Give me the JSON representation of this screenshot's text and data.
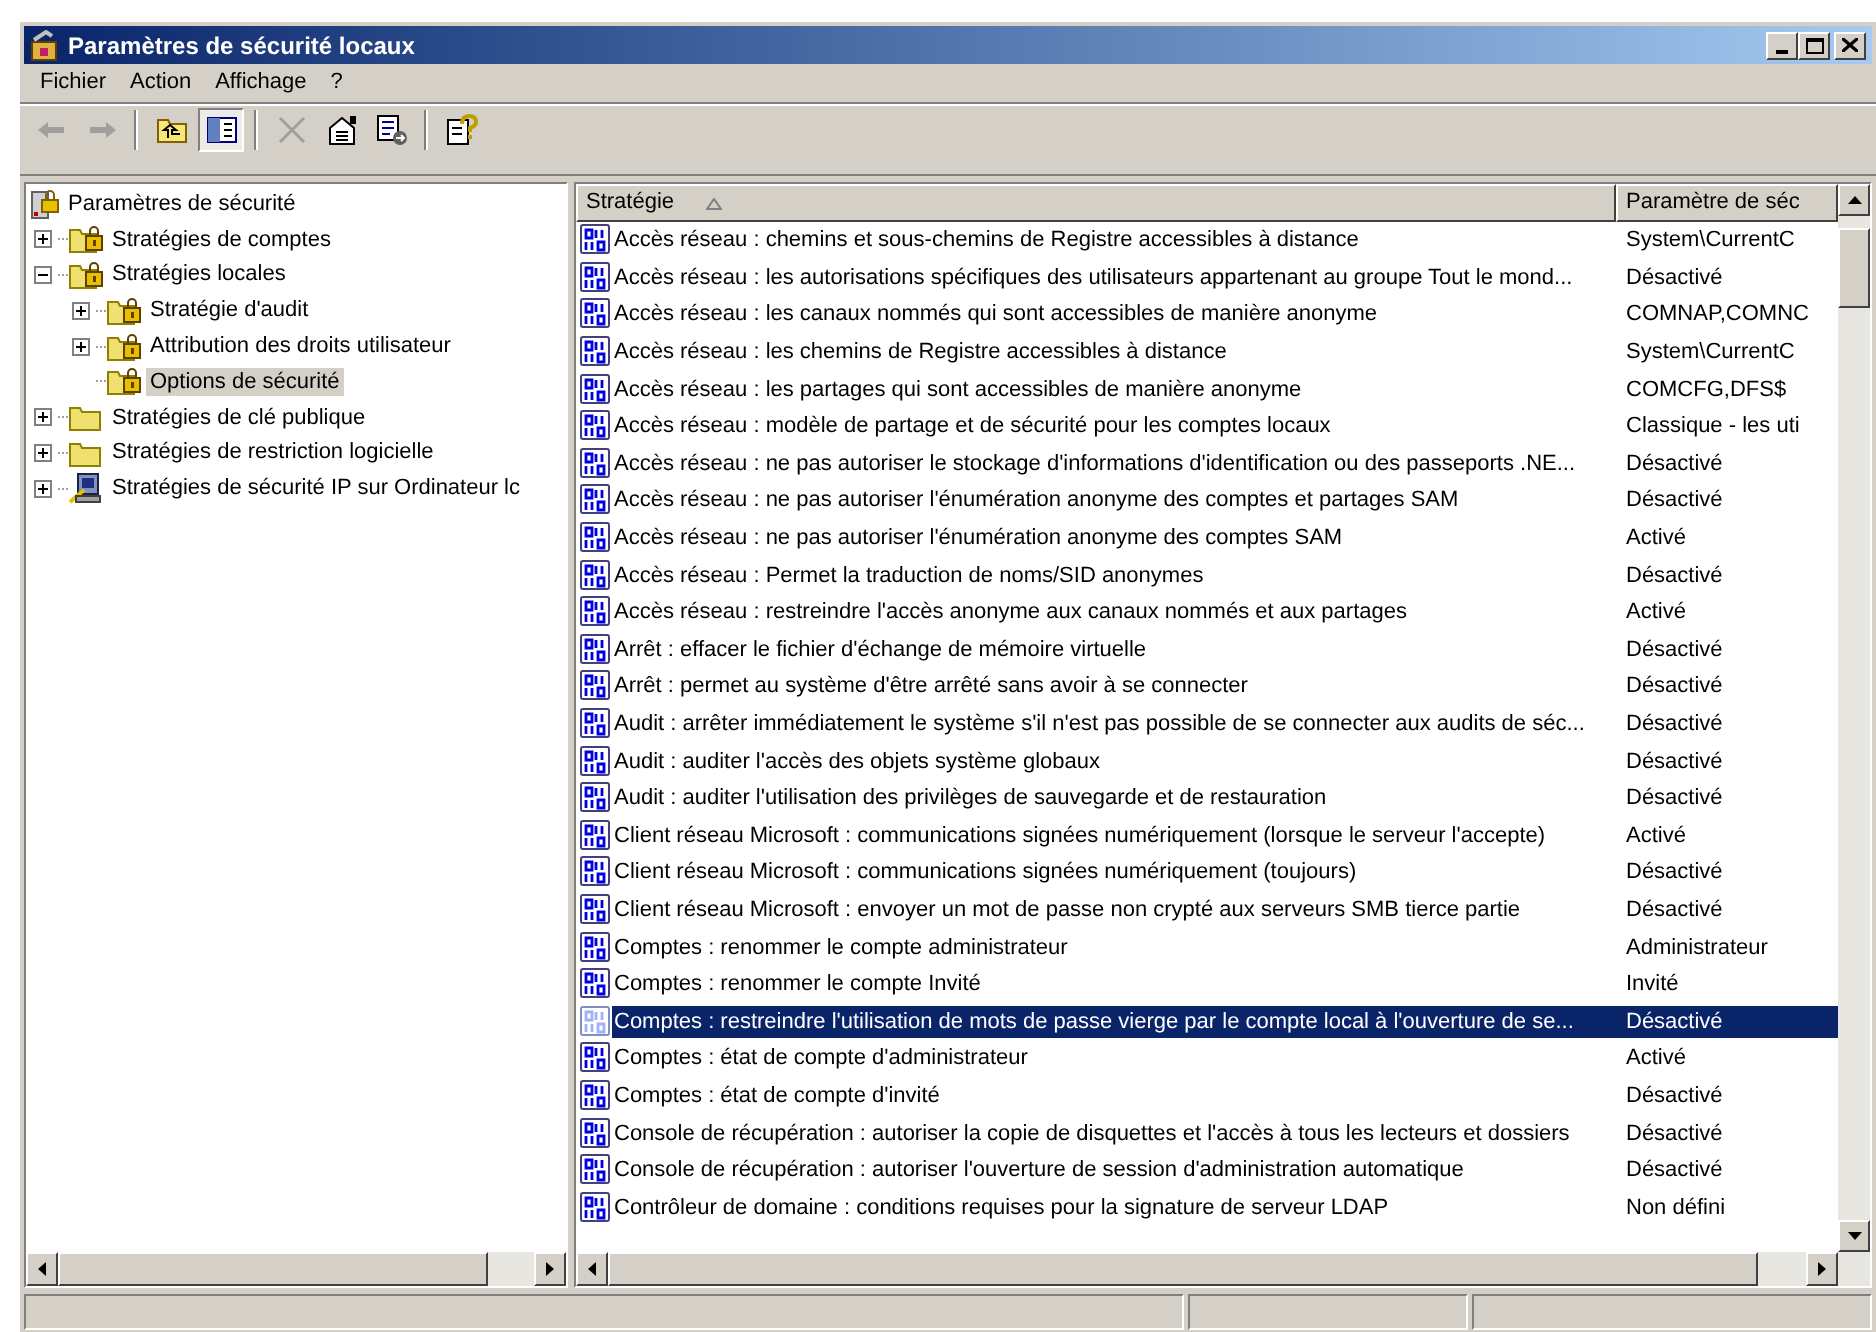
{
  "window": {
    "title": "Paramètres de sécurité locaux"
  },
  "menu": [
    {
      "label": "Fichier"
    },
    {
      "label": "Action"
    },
    {
      "label": "Affichage"
    },
    {
      "label": "?"
    }
  ],
  "toolbar": [
    {
      "kind": "back",
      "disabled": true
    },
    {
      "kind": "forward",
      "disabled": true
    },
    {
      "kind": "separator"
    },
    {
      "kind": "up",
      "disabled": false
    },
    {
      "kind": "tree",
      "disabled": false,
      "pressed": true
    },
    {
      "kind": "separator"
    },
    {
      "kind": "delete",
      "disabled": true
    },
    {
      "kind": "properties",
      "disabled": false
    },
    {
      "kind": "export",
      "disabled": false
    },
    {
      "kind": "separator"
    },
    {
      "kind": "help",
      "disabled": false
    }
  ],
  "tree": [
    {
      "label": "Paramètres de sécurité",
      "kind": "root",
      "selected": false,
      "children": [
        {
          "label": "Stratégies de comptes",
          "kind": "lockfolder",
          "selected": false,
          "expanded": false
        },
        {
          "label": "Stratégies locales",
          "kind": "lockfolder",
          "selected": false,
          "expanded": true,
          "children": [
            {
              "label": "Stratégie d'audit",
              "kind": "lockfolder",
              "selected": false,
              "expanded": false
            },
            {
              "label": "Attribution des droits utilisateur",
              "kind": "lockfolder",
              "selected": false,
              "expanded": false
            },
            {
              "label": "Options de sécurité",
              "kind": "lockfolder",
              "selected": true
            }
          ]
        },
        {
          "label": "Stratégies de clé publique",
          "kind": "folder",
          "selected": false,
          "expanded": false
        },
        {
          "label": "Stratégies de restriction logicielle",
          "kind": "folder",
          "selected": false,
          "expanded": false
        },
        {
          "label": "Stratégies de sécurité IP sur Ordinateur lc",
          "kind": "computer",
          "selected": false,
          "expanded": false
        }
      ]
    }
  ],
  "table": {
    "columns": [
      {
        "label": "Stratégie",
        "sorted": true
      },
      {
        "label": "Paramètre de séc",
        "sorted": false
      }
    ],
    "rows": [
      {
        "policy": "Accès réseau : chemins et sous-chemins de Registre accessibles à distance",
        "setting": "System\\CurrentC",
        "selected": false
      },
      {
        "policy": "Accès réseau : les autorisations spécifiques des utilisateurs appartenant au groupe Tout le mond...",
        "setting": "Désactivé",
        "selected": false
      },
      {
        "policy": "Accès réseau : les canaux nommés qui sont accessibles de manière anonyme",
        "setting": "COMNAP,COMNC",
        "selected": false
      },
      {
        "policy": "Accès réseau : les chemins de Registre accessibles à distance",
        "setting": "System\\CurrentC",
        "selected": false
      },
      {
        "policy": "Accès réseau : les partages qui sont accessibles de manière anonyme",
        "setting": "COMCFG,DFS$",
        "selected": false
      },
      {
        "policy": "Accès réseau : modèle de partage et de sécurité pour les comptes locaux",
        "setting": "Classique - les uti",
        "selected": false
      },
      {
        "policy": "Accès réseau : ne pas autoriser le stockage d'informations d'identification ou des passeports .NE...",
        "setting": "Désactivé",
        "selected": false
      },
      {
        "policy": "Accès réseau : ne pas autoriser l'énumération anonyme des comptes et partages SAM",
        "setting": "Désactivé",
        "selected": false
      },
      {
        "policy": "Accès réseau : ne pas autoriser l'énumération anonyme des comptes SAM",
        "setting": "Activé",
        "selected": false
      },
      {
        "policy": "Accès réseau : Permet la traduction de noms/SID anonymes",
        "setting": "Désactivé",
        "selected": false
      },
      {
        "policy": "Accès réseau : restreindre l'accès anonyme aux canaux nommés et aux partages",
        "setting": "Activé",
        "selected": false
      },
      {
        "policy": "Arrêt : effacer le fichier d'échange de mémoire virtuelle",
        "setting": "Désactivé",
        "selected": false
      },
      {
        "policy": "Arrêt : permet au système d'être arrêté sans avoir à se connecter",
        "setting": "Désactivé",
        "selected": false
      },
      {
        "policy": "Audit : arrêter immédiatement le système s'il n'est pas possible de se connecter aux audits de séc...",
        "setting": "Désactivé",
        "selected": false
      },
      {
        "policy": "Audit : auditer l'accès des objets système globaux",
        "setting": "Désactivé",
        "selected": false
      },
      {
        "policy": "Audit : auditer l'utilisation des privilèges de sauvegarde et de restauration",
        "setting": "Désactivé",
        "selected": false
      },
      {
        "policy": "Client réseau Microsoft : communications signées numériquement (lorsque le serveur l'accepte)",
        "setting": "Activé",
        "selected": false
      },
      {
        "policy": "Client réseau Microsoft : communications signées numériquement (toujours)",
        "setting": "Désactivé",
        "selected": false
      },
      {
        "policy": "Client réseau Microsoft : envoyer un mot de passe non crypté aux serveurs SMB tierce partie",
        "setting": "Désactivé",
        "selected": false
      },
      {
        "policy": "Comptes : renommer le compte administrateur",
        "setting": "Administrateur",
        "selected": false
      },
      {
        "policy": "Comptes : renommer le compte Invité",
        "setting": "Invité",
        "selected": false
      },
      {
        "policy": "Comptes : restreindre l'utilisation de mots de passe vierge par le compte local à l'ouverture de se...",
        "setting": "Désactivé",
        "selected": true
      },
      {
        "policy": "Comptes : état de compte d'administrateur",
        "setting": "Activé",
        "selected": false
      },
      {
        "policy": "Comptes : état de compte d'invité",
        "setting": "Désactivé",
        "selected": false
      },
      {
        "policy": "Console de récupération : autoriser la copie de disquettes et l'accès à tous les lecteurs et dossiers",
        "setting": "Désactivé",
        "selected": false
      },
      {
        "policy": "Console de récupération : autoriser l'ouverture de session d'administration automatique",
        "setting": "Désactivé",
        "selected": false
      },
      {
        "policy": "Contrôleur de domaine : conditions requises pour la signature de serveur LDAP",
        "setting": "Non défini",
        "selected": false
      }
    ]
  }
}
